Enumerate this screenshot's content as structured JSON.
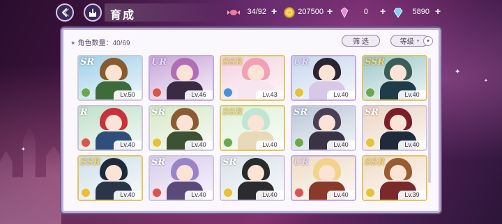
{
  "header": {
    "title": "育成",
    "back_icon": "back-arrow-icon",
    "home_icon": "castle-home-icon"
  },
  "resources": [
    {
      "name": "candy",
      "icon": "candy-icon",
      "value": "34/92",
      "color": "#f07a9a"
    },
    {
      "name": "gold",
      "icon": "gold-coin-icon",
      "value": "207500",
      "color": "#f2c241"
    },
    {
      "name": "pink-gem",
      "icon": "pink-gem-icon",
      "value": "0",
      "color": "#e88ad8"
    },
    {
      "name": "blue-gem",
      "icon": "blue-gem-icon",
      "value": "5890",
      "color": "#7ad3f0"
    }
  ],
  "panel": {
    "count_label": "角色数量",
    "count_value": "40/69",
    "filter_label": "筛 选",
    "sort_label": "等级"
  },
  "cards": [
    {
      "rarity": "SR",
      "level": "Lv.50",
      "attr": "#6aa84f",
      "hair": "#8a5a2b",
      "body": "#3f6b3a",
      "bg": "#9fd0e8"
    },
    {
      "rarity": "UR",
      "level": "Lv.46",
      "attr": "#d9534f",
      "hair": "#b06fb4",
      "body": "#3a2a44",
      "bg": "#c7a7d8"
    },
    {
      "rarity": "SSR",
      "level": "Lv.43",
      "attr": "#4a90d9",
      "hair": "#f2a0b6",
      "body": "#f7e6ef",
      "bg": "#f3d2df"
    },
    {
      "rarity": "UR",
      "level": "Lv.40",
      "attr": "#e5c23a",
      "hair": "#2c2430",
      "body": "#d7c8e8",
      "bg": "#c7d6ee"
    },
    {
      "rarity": "SSR",
      "level": "Lv.40",
      "attr": "#6aa84f",
      "hair": "#3c5e58",
      "body": "#1e3c4a",
      "bg": "#9fc8c9"
    },
    {
      "rarity": "R",
      "level": "Lv.40",
      "attr": "#d9534f",
      "hair": "#c8303a",
      "body": "#2f4f7a",
      "bg": "#bfe0c8"
    },
    {
      "rarity": "SR",
      "level": "Lv.40",
      "attr": "#e5c23a",
      "hair": "#8b5a32",
      "body": "#3c5232",
      "bg": "#d6e8c6"
    },
    {
      "rarity": "SSR",
      "level": "Lv.40",
      "attr": "#6aa84f",
      "hair": "#bfe6d4",
      "body": "#e8d9b8",
      "bg": "#dff0d8"
    },
    {
      "rarity": "SR",
      "level": "Lv.40",
      "attr": "#6aa84f",
      "hair": "#4a3f55",
      "body": "#3a3346",
      "bg": "#b8c6d8"
    },
    {
      "rarity": "SR",
      "level": "Lv.40",
      "attr": "#e5c23a",
      "hair": "#7a1f28",
      "body": "#1f2a3a",
      "bg": "#ecd5c3"
    },
    {
      "rarity": "SSR",
      "level": "Lv.40",
      "attr": "#e5c23a",
      "hair": "#1d2a3a",
      "body": "#2a3648",
      "bg": "#cfe0ea"
    },
    {
      "rarity": "SR",
      "level": "Lv.40",
      "attr": "#d9534f",
      "hair": "#9a84c8",
      "body": "#5a4a7a",
      "bg": "#d7ccec"
    },
    {
      "rarity": "SR",
      "level": "Lv.40",
      "attr": "#e5c23a",
      "hair": "#2a2a2a",
      "body": "#2c2c30",
      "bg": "#d8e2ea"
    },
    {
      "rarity": "UR",
      "level": "Lv.40",
      "attr": "#d9534f",
      "hair": "#f1d38a",
      "body": "#8a3a2a",
      "bg": "#efdcc6"
    },
    {
      "rarity": "SSR",
      "level": "Lv.39",
      "attr": "#e5c23a",
      "hair": "#9a5b30",
      "body": "#7a2a2a",
      "bg": "#f0dcc8"
    }
  ]
}
